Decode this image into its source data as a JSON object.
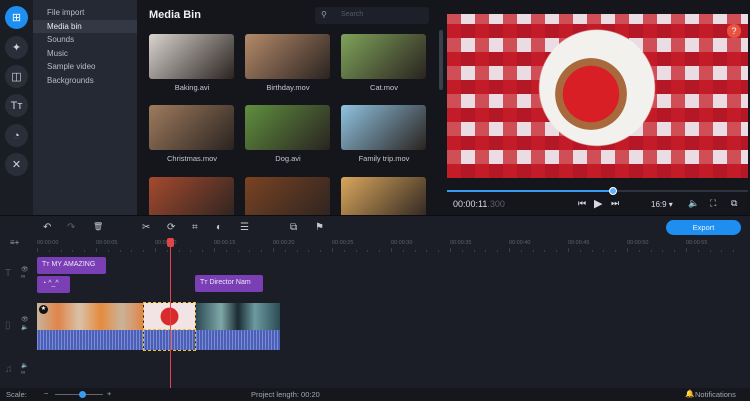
{
  "iconbar": [
    {
      "icon": "import-icon",
      "glyph": "⊞"
    },
    {
      "icon": "magic-wand-icon",
      "glyph": "✦"
    },
    {
      "icon": "transitions-icon",
      "glyph": "◫"
    },
    {
      "icon": "titles-icon",
      "glyph": "Tт"
    },
    {
      "icon": "stickers-icon",
      "glyph": "◔"
    },
    {
      "icon": "tools-icon",
      "glyph": "✕"
    }
  ],
  "sidebar": {
    "items": [
      {
        "label": "File import"
      },
      {
        "label": "Media bin",
        "active": true
      },
      {
        "label": "Sounds"
      },
      {
        "label": "Music"
      },
      {
        "label": "Sample video"
      },
      {
        "label": "Backgrounds"
      }
    ]
  },
  "mediabin": {
    "title": "Media Bin",
    "search_placeholder": "Search",
    "items": [
      {
        "name": "Baking.avi",
        "color": "#d9d4cf"
      },
      {
        "name": "Birthday.mov",
        "color": "#b58a6a"
      },
      {
        "name": "Cat.mov",
        "color": "#7fa35a"
      },
      {
        "name": "Christmas.mov",
        "color": "#9e7b5e"
      },
      {
        "name": "Dog.avi",
        "color": "#5f8f3f"
      },
      {
        "name": "Family trip.mov",
        "color": "#8fc2e0"
      },
      {
        "name": "",
        "color": "#a54a2e"
      },
      {
        "name": "",
        "color": "#7a4322"
      },
      {
        "name": "",
        "color": "#d9a65c"
      }
    ]
  },
  "preview": {
    "help": "?",
    "time_main": "00:00:11",
    "time_ms": ".300",
    "progress": 0.55,
    "aspect": "16:9 ▾",
    "buttons": {
      "prev": "⏮",
      "play": "▶",
      "next": "⏭",
      "volume": "🔈",
      "fullscreen": "⛶",
      "detach": "⧉"
    }
  },
  "toolbar": {
    "undo": "↶",
    "redo": "↷",
    "delete": "🗑",
    "cut": "✂",
    "rotate": "⟳",
    "crop": "⌗",
    "color": "◐",
    "adjust": "☰",
    "overlay": "⧉",
    "marker": "⚑",
    "add_track": "≡+",
    "export": "Export"
  },
  "ruler": [
    "00:00:00",
    "00:00:05",
    "00:00:10",
    "00:00:15",
    "00:00:20",
    "00:00:25",
    "00:00:30",
    "00:00:35",
    "00:00:40",
    "00:00:45",
    "00:00:50",
    "00:00:55"
  ],
  "timeline": {
    "title_clip_1": "MY AMAZING",
    "title_clip_2": "^_^",
    "title_clip_3": "Director Nam",
    "playhead_seconds": 11.3
  },
  "status": {
    "scale_label": "Scale:",
    "project_length": "Project length: 00:20",
    "notifications": "Notifications",
    "scale_value": 0.5
  }
}
